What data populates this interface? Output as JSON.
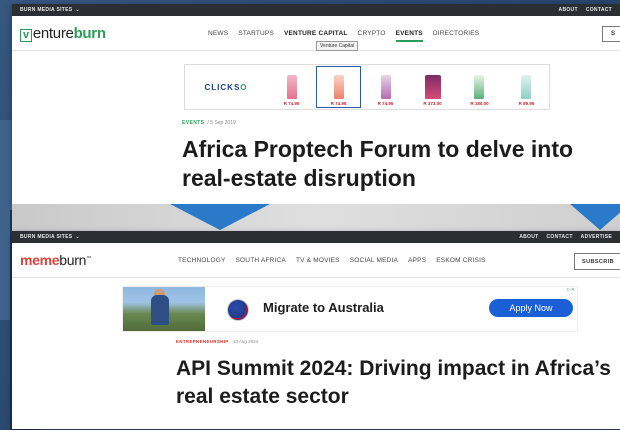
{
  "win1": {
    "network_label": "BURN MEDIA SITES",
    "top_links": [
      "ABOUT",
      "CONTACT"
    ],
    "logo_letter": "v",
    "logo_rest": "enture",
    "logo_tail": "burn",
    "nav": [
      "NEWS",
      "STARTUPS",
      "VENTURE CAPITAL",
      "CRYPTO",
      "EVENTS",
      "DIRECTORIES"
    ],
    "active_nav": "EVENTS",
    "tooltip": "Venture Capital",
    "subscribe_partial": "S",
    "ad": {
      "brand_a": "CLICKS",
      "brand_b": "O",
      "prices": [
        "R 74.95",
        "R 74.95",
        "R 74.95",
        "R 373.00",
        "R 180.00",
        "R 89.95"
      ]
    },
    "category": "EVENTS",
    "date": "5 Sep 2019",
    "headline": "Africa Proptech Forum to delve into real-estate disruption"
  },
  "win2": {
    "network_label": "BURN MEDIA SITES",
    "top_links": [
      "ABOUT",
      "CONTACT",
      "ADVERTISE"
    ],
    "logo_main": "meme",
    "logo_tail": "burn",
    "nav": [
      "TECHNOLOGY",
      "SOUTH AFRICA",
      "TV & MOVIES",
      "SOCIAL MEDIA",
      "APPS",
      "ESKOM CRISIS"
    ],
    "subscribe": "SUBSCRIB",
    "ad": {
      "text": "Migrate to Australia",
      "button": "Apply Now"
    },
    "category": "ENTREPRENEURSHIP",
    "date": "13 Aug 2024",
    "headline": "API Summit 2024: Driving impact in Africa’s real estate sector"
  },
  "colors": {
    "ventureburn_green": "#2c9c58",
    "memeburn_red": "#e0433a",
    "backdrop_blue": "#2a4a72",
    "apply_button": "#1a5fd6"
  }
}
